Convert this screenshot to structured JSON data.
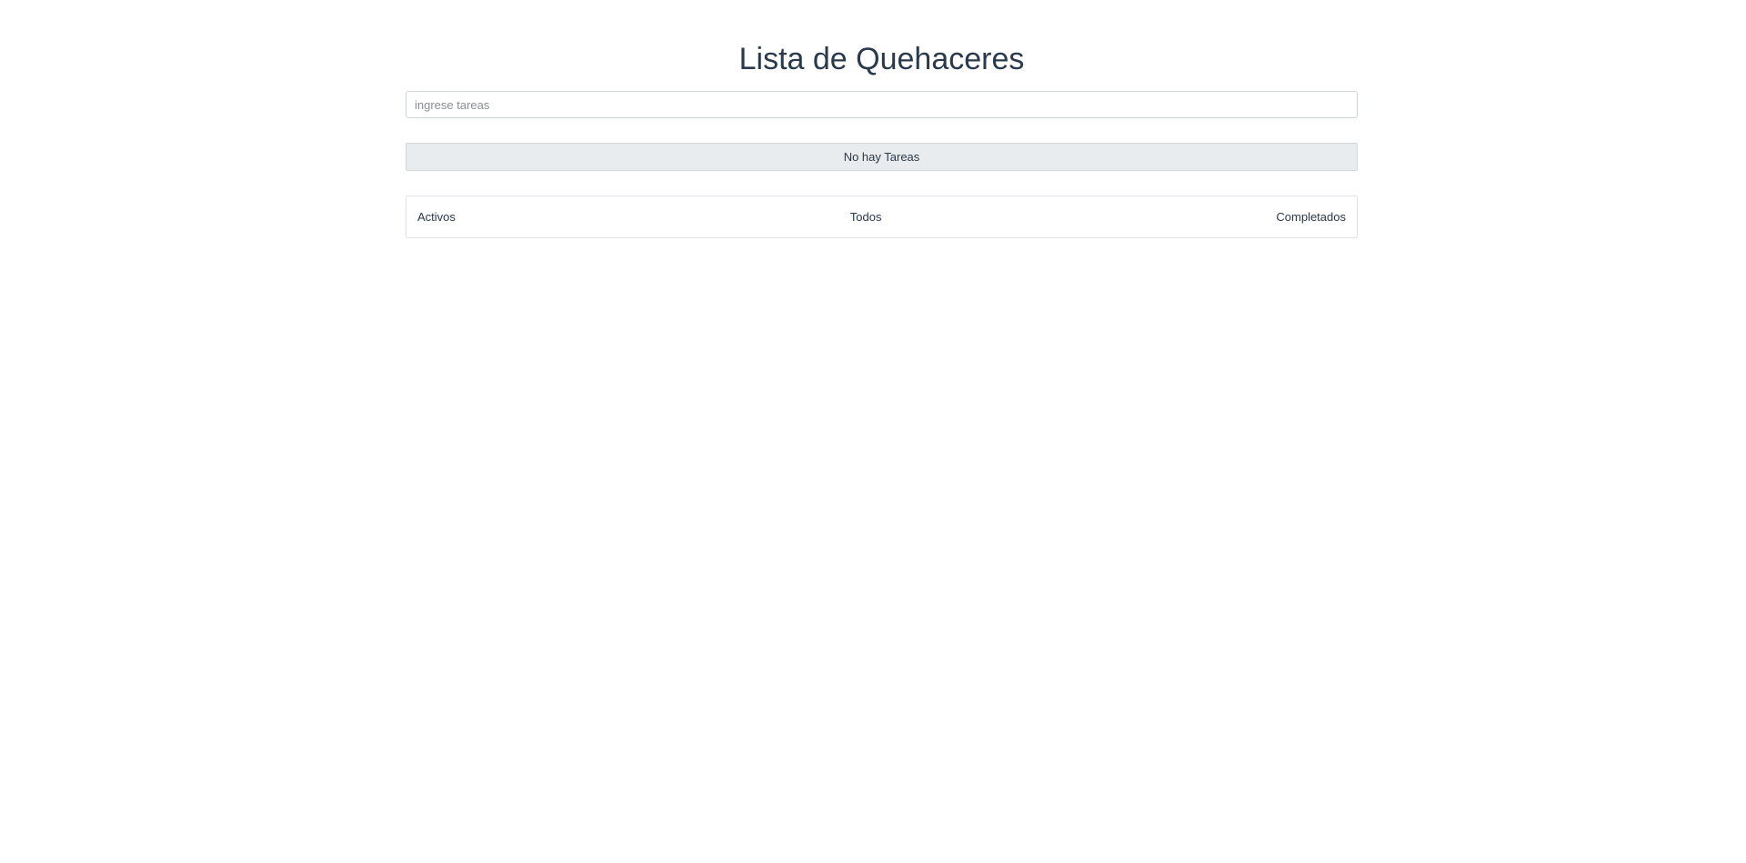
{
  "header": {
    "title": "Lista de Quehaceres"
  },
  "task_input": {
    "placeholder": "ingrese tareas",
    "value": ""
  },
  "task_list": {
    "empty_message": "No hay Tareas"
  },
  "filters": {
    "active": "Activos",
    "all": "Todos",
    "completed": "Completados"
  }
}
